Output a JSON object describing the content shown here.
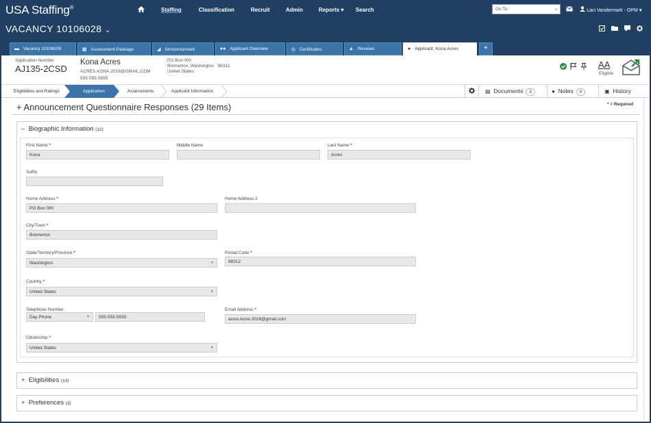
{
  "topnav": {
    "logo": "USA Staffing",
    "logo_mark": "®",
    "items": [
      "Staffing",
      "Classification",
      "Recruit",
      "Admin",
      "Reports",
      "Search"
    ],
    "active": "Staffing",
    "goto_placeholder": "Go To",
    "user": "Laci Vandermark - OPM"
  },
  "vacancy": {
    "title": "VACANCY 10106028"
  },
  "tabs": [
    {
      "label": "Vacancy 10106028",
      "icon": "folder-icon"
    },
    {
      "label": "Assessment Package",
      "icon": "package-icon"
    },
    {
      "label": "Announcement",
      "icon": "megaphone-icon"
    },
    {
      "label": "Applicant Overview",
      "icon": "users-icon"
    },
    {
      "label": "Certificates",
      "icon": "certificate-icon"
    },
    {
      "label": "Reviews",
      "icon": "thumbs-up-icon"
    },
    {
      "label": "Applicant: Kona Acres",
      "icon": "user-icon"
    }
  ],
  "add_tab": "+",
  "applicant": {
    "app_number_label": "Application Number",
    "app_number": "AJ135-2CSD",
    "name": "Kona Acres",
    "email": "ACRES.KONA.2018@GMAIL.COM",
    "phone": "555-555-5555",
    "address1": "PO Box 000",
    "address2": "Bremerton, Washington",
    "zip": "98312",
    "country": "United States",
    "status_icon_text": "AA",
    "status": "Eligible"
  },
  "breadcrumb": [
    "Eligibilities and Ratings",
    "Application",
    "Assessments",
    "Applicant Information"
  ],
  "right_tabs": {
    "documents": "Documents",
    "documents_count": "3",
    "notes": "Notes",
    "notes_count": "0",
    "history": "History"
  },
  "questionnaire": {
    "title": "Announcement Questionnaire Responses (29 Items)",
    "expand_symbol": "+",
    "required_note": "* = Required"
  },
  "sections": {
    "bio": {
      "symbol": "–",
      "label": "Biographic Information",
      "count": "(12)"
    },
    "elig": {
      "symbol": "+",
      "label": "Eligibilities",
      "count": "(13)"
    },
    "pref": {
      "symbol": "+",
      "label": "Preferences",
      "count": "(3)"
    }
  },
  "form": {
    "first_name": {
      "label": "First Name",
      "value": "Kona",
      "req": "*"
    },
    "middle_name": {
      "label": "Middle Name",
      "value": ""
    },
    "last_name": {
      "label": "Last Name",
      "value": "Acres",
      "req": "*"
    },
    "suffix": {
      "label": "Suffix",
      "value": ""
    },
    "home_address": {
      "label": "Home Address",
      "value": "PO Box 000",
      "req": "*"
    },
    "home_address2": {
      "label": "Home Address 2",
      "value": ""
    },
    "city": {
      "label": "City/Town",
      "value": "Bremerton",
      "req": "*"
    },
    "state": {
      "label": "State/Territory/Province",
      "value": "Washington",
      "req": "*"
    },
    "postal": {
      "label": "Postal Code",
      "value": "98312",
      "req": "*"
    },
    "country": {
      "label": "Country",
      "value": "United States",
      "req": "*"
    },
    "phone": {
      "label": "Telephone Number",
      "type": "Day Phone",
      "value": "555-555-5555"
    },
    "email": {
      "label": "Email Address",
      "value": "acres.kona.2018@gmail.com",
      "req": "*"
    },
    "citizenship": {
      "label": "Citizenship",
      "value": "United States",
      "req": "*"
    }
  }
}
